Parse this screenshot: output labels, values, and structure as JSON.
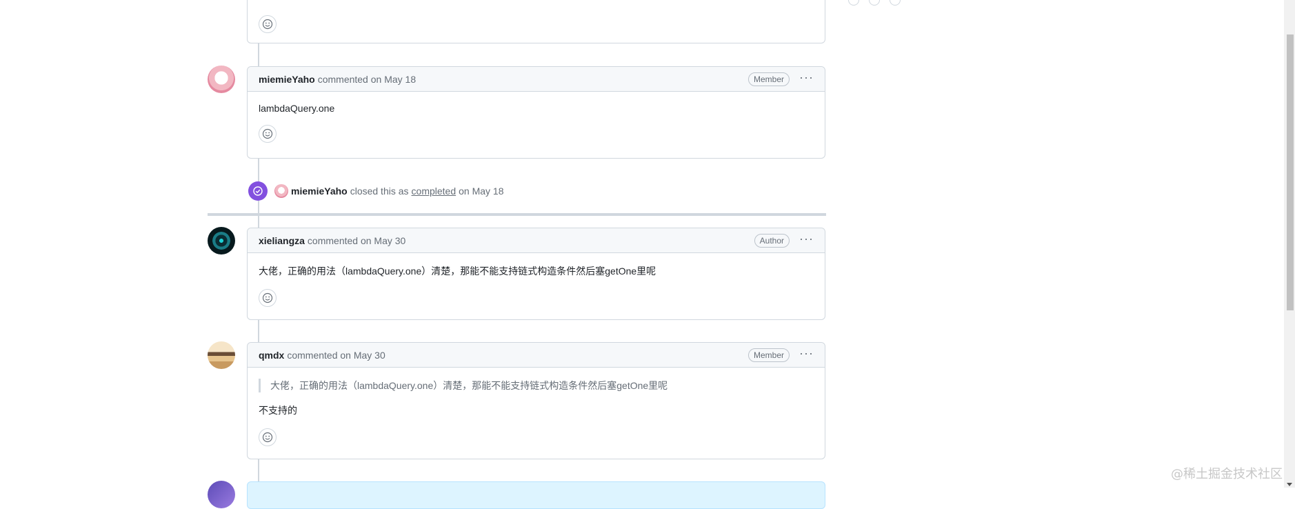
{
  "comments": [
    {
      "author": "",
      "meta": "",
      "badge": "",
      "body": "",
      "reaction_icon": "smiley-icon"
    },
    {
      "author": "miemieYaho",
      "meta": "commented on May 18",
      "badge": "Member",
      "body": "lambdaQuery.one",
      "reaction_icon": "smiley-icon"
    },
    {
      "author": "xieliangza",
      "meta": "commented on May 30",
      "badge": "Author",
      "body": "大佬，正确的用法（lambdaQuery.one）清楚，那能不能支持链式构造条件然后塞getOne里呢",
      "reaction_icon": "smiley-icon"
    },
    {
      "author": "qmdx",
      "meta": "commented on May 30",
      "badge": "Member",
      "quote": "大佬，正确的用法（lambdaQuery.one）清楚，那能不能支持链式构造条件然后塞getOne里呢",
      "body": "不支持的",
      "reaction_icon": "smiley-icon"
    }
  ],
  "event": {
    "actor": "miemieYaho",
    "text_before": "closed this as",
    "link": "completed",
    "text_after": "on May 18",
    "color": "#8250df"
  },
  "kebab_label": "···",
  "watermark": "@稀土掘金技术社区"
}
